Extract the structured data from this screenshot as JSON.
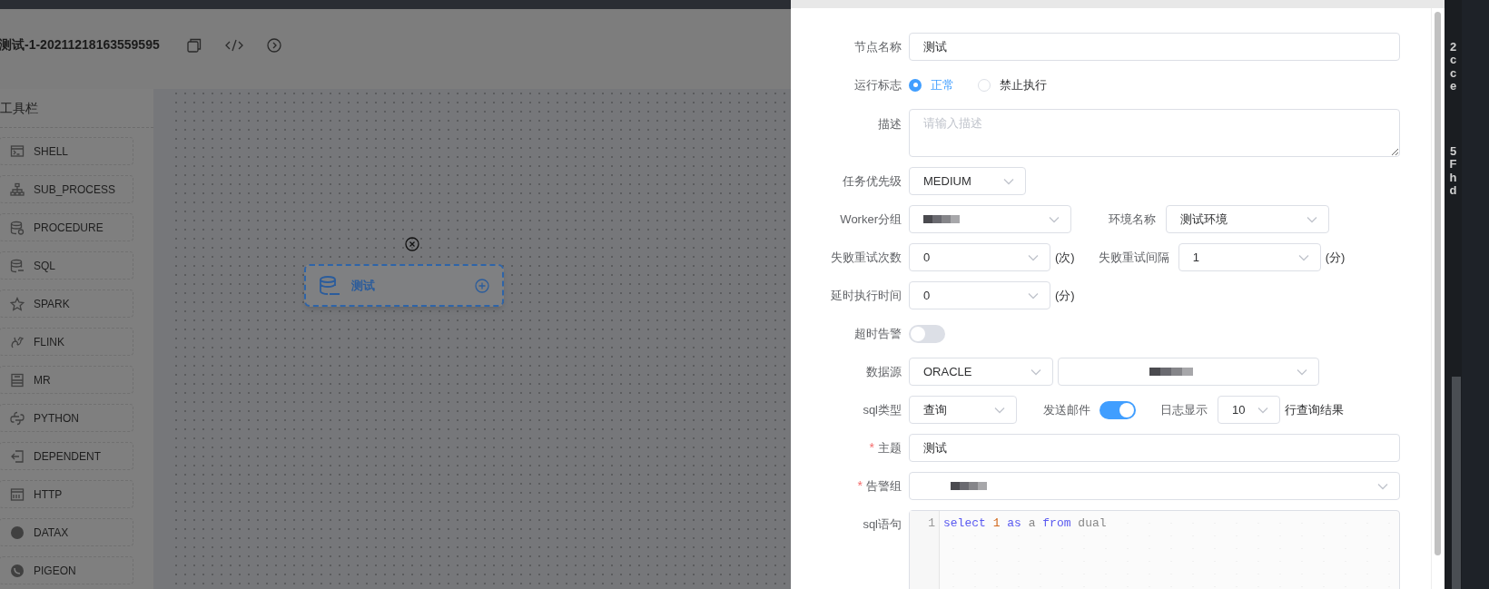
{
  "header": {
    "title": "测试-1-20211218163559595"
  },
  "toolbar": {
    "title": "工具栏",
    "items": [
      {
        "label": "SHELL",
        "kind": "shell"
      },
      {
        "label": "SUB_PROCESS",
        "kind": "sub_process"
      },
      {
        "label": "PROCEDURE",
        "kind": "procedure"
      },
      {
        "label": "SQL",
        "kind": "sql"
      },
      {
        "label": "SPARK",
        "kind": "spark"
      },
      {
        "label": "FLINK",
        "kind": "flink"
      },
      {
        "label": "MR",
        "kind": "mr"
      },
      {
        "label": "PYTHON",
        "kind": "python"
      },
      {
        "label": "DEPENDENT",
        "kind": "dependent"
      },
      {
        "label": "HTTP",
        "kind": "http"
      },
      {
        "label": "DATAX",
        "kind": "datax"
      },
      {
        "label": "PIGEON",
        "kind": "pigeon"
      }
    ]
  },
  "canvas": {
    "nodes": [
      {
        "label": "测试",
        "selected": true
      }
    ]
  },
  "form": {
    "node_name": {
      "label": "节点名称",
      "value": "测试"
    },
    "run_flag": {
      "label": "运行标志",
      "options": [
        {
          "label": "正常",
          "selected": true
        },
        {
          "label": "禁止执行",
          "selected": false
        }
      ]
    },
    "description": {
      "label": "描述",
      "placeholder": "请输入描述"
    },
    "priority": {
      "label": "任务优先级",
      "value": "MEDIUM"
    },
    "worker_group": {
      "label": "Worker分组"
    },
    "environment": {
      "label": "环境名称",
      "value": "测试环境"
    },
    "retry_times": {
      "label": "失败重试次数",
      "value": "0",
      "unit": "(次)"
    },
    "retry_interval": {
      "label": "失败重试间隔",
      "value": "1",
      "unit": "(分)"
    },
    "delay_time": {
      "label": "延时执行时间",
      "value": "0",
      "unit": "(分)"
    },
    "timeout_alert": {
      "label": "超时告警",
      "on": false
    },
    "datasource": {
      "label": "数据源",
      "type": "ORACLE"
    },
    "sql_type": {
      "label": "sql类型",
      "value": "查询"
    },
    "send_email": {
      "label": "发送邮件",
      "on": true
    },
    "log_display": {
      "label": "日志显示",
      "value": "10",
      "suffix": "行查询结果"
    },
    "subject": {
      "label": "主题",
      "mark": "*",
      "value": "测试"
    },
    "alert_group": {
      "label": "告警组",
      "mark": "*"
    },
    "sql": {
      "label": "sql语句",
      "lines": [
        {
          "number": "1",
          "tokens": [
            {
              "text": "select",
              "kind": "keyword"
            },
            {
              "text": "1",
              "kind": "number"
            },
            {
              "text": "as",
              "kind": "keyword"
            },
            {
              "text": "a",
              "kind": "plain"
            },
            {
              "text": "from",
              "kind": "keyword"
            },
            {
              "text": "dual",
              "kind": "plain"
            }
          ]
        }
      ]
    }
  },
  "side_strip": {
    "texts": [
      "2cce",
      "5Fhd"
    ]
  }
}
